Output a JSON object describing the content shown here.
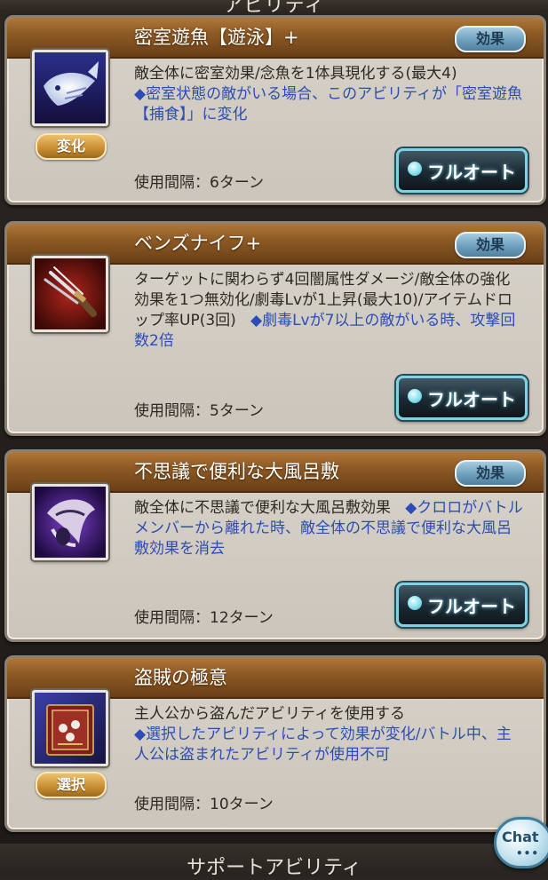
{
  "header": {
    "title": "アビリティ"
  },
  "footer": {
    "title": "サポートアビリティ"
  },
  "chat": {
    "label": "Chat",
    "dots": "•••"
  },
  "skills": [
    {
      "name": "密室遊魚【遊泳】+",
      "effect_label": "効果",
      "tag": "変化",
      "desc": "敵全体に密室効果/念魚を1体具現化する(最大4)",
      "highlight": "◆密室状態の敵がいる場合、このアビリティが「密室遊魚【捕食】」に変化",
      "interval": "使用間隔：6ターン",
      "auto_label": "フルオート",
      "icon": "ghost-fish-icon"
    },
    {
      "name": "ベンズナイフ+",
      "effect_label": "効果",
      "desc": "ターゲットに関わらず4回闇属性ダメージ/敵全体の強化効果を1つ無効化/劇毒Lvが1上昇(最大10)/アイテムドロップ率UP(3回)",
      "highlight": "◆劇毒Lvが7以上の敵がいる時、攻撃回数2倍",
      "interval": "使用間隔：5ターン",
      "auto_label": "フルオート",
      "icon": "knife-icon"
    },
    {
      "name": "不思議で便利な大風呂敷",
      "effect_label": "効果",
      "desc": "敵全体に不思議で便利な大風呂敷効果",
      "highlight": "◆クロロがバトルメンバーから離れた時、敵全体の不思議で便利な大風呂敷効果を消去",
      "interval": "使用間隔：12ターン",
      "auto_label": "フルオート",
      "icon": "cloth-icon"
    },
    {
      "name": "盗賊の極意",
      "tag": "選択",
      "desc": "主人公から盗んだアビリティを使用する",
      "highlight": "◆選択したアビリティによって効果が変化/バトル中、主人公は盗まれたアビリティが使用不可",
      "interval": "使用間隔：10ターン",
      "icon": "book-icon"
    }
  ]
}
